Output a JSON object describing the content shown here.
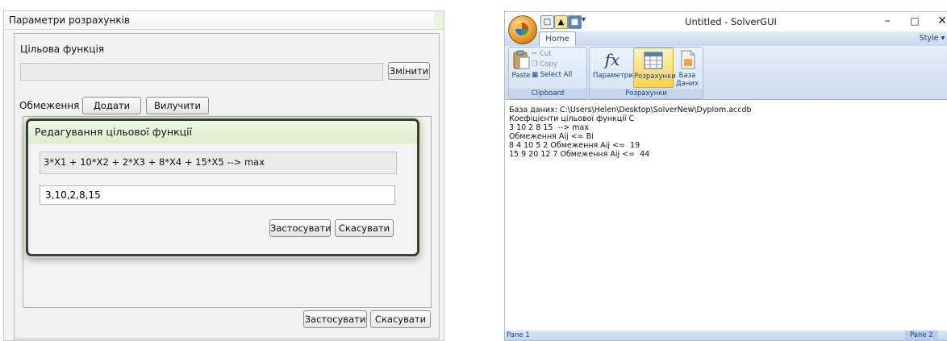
{
  "params_dialog": {
    "title": "Параметри розрахунків",
    "objective_label": "Цільова функція",
    "change_button": "Змінити",
    "constraints_label": "Обмеження",
    "add_button": "Додати",
    "remove_button": "Вилучити",
    "apply_button": "Застосувати",
    "cancel_button": "Скасувати"
  },
  "edit_dialog": {
    "title": "Редагування цільової функції",
    "expression": "3*X1 + 10*X2 + 2*X3 + 8*X4 + 15*X5 --> max",
    "coefficients_value": "3,10,2,8,15",
    "apply_button": "Застосувати",
    "cancel_button": "Скасувати"
  },
  "solver_window": {
    "title": "Untitled - SolverGUI",
    "tab_home": "Home",
    "style_menu": "Style",
    "clipboard": {
      "paste": "Paste",
      "cut": "Cut",
      "copy": "Copy",
      "select_all": "Select All",
      "group_label": "Clipboard"
    },
    "calc": {
      "params": "Параметри",
      "calc": "Розрахунки",
      "db_line1": "База",
      "db_line2": "Даних",
      "group_label": "Розрахунки"
    },
    "content_lines": [
      "База даних: C:\\Users\\Helen\\Desktop\\SolverNew\\Dyplom.accdb",
      "Коефіцієнти цільової функції C",
      "3 10 2 8 15  --> max",
      "Обмеження Aij <= Bi",
      "8 4 10 5 2 Обмеження Aij <=  19",
      "15 9 20 12 7 Обмеження Aij <=  44"
    ],
    "status_left": "Pane 1",
    "status_right": "Pane 2"
  }
}
